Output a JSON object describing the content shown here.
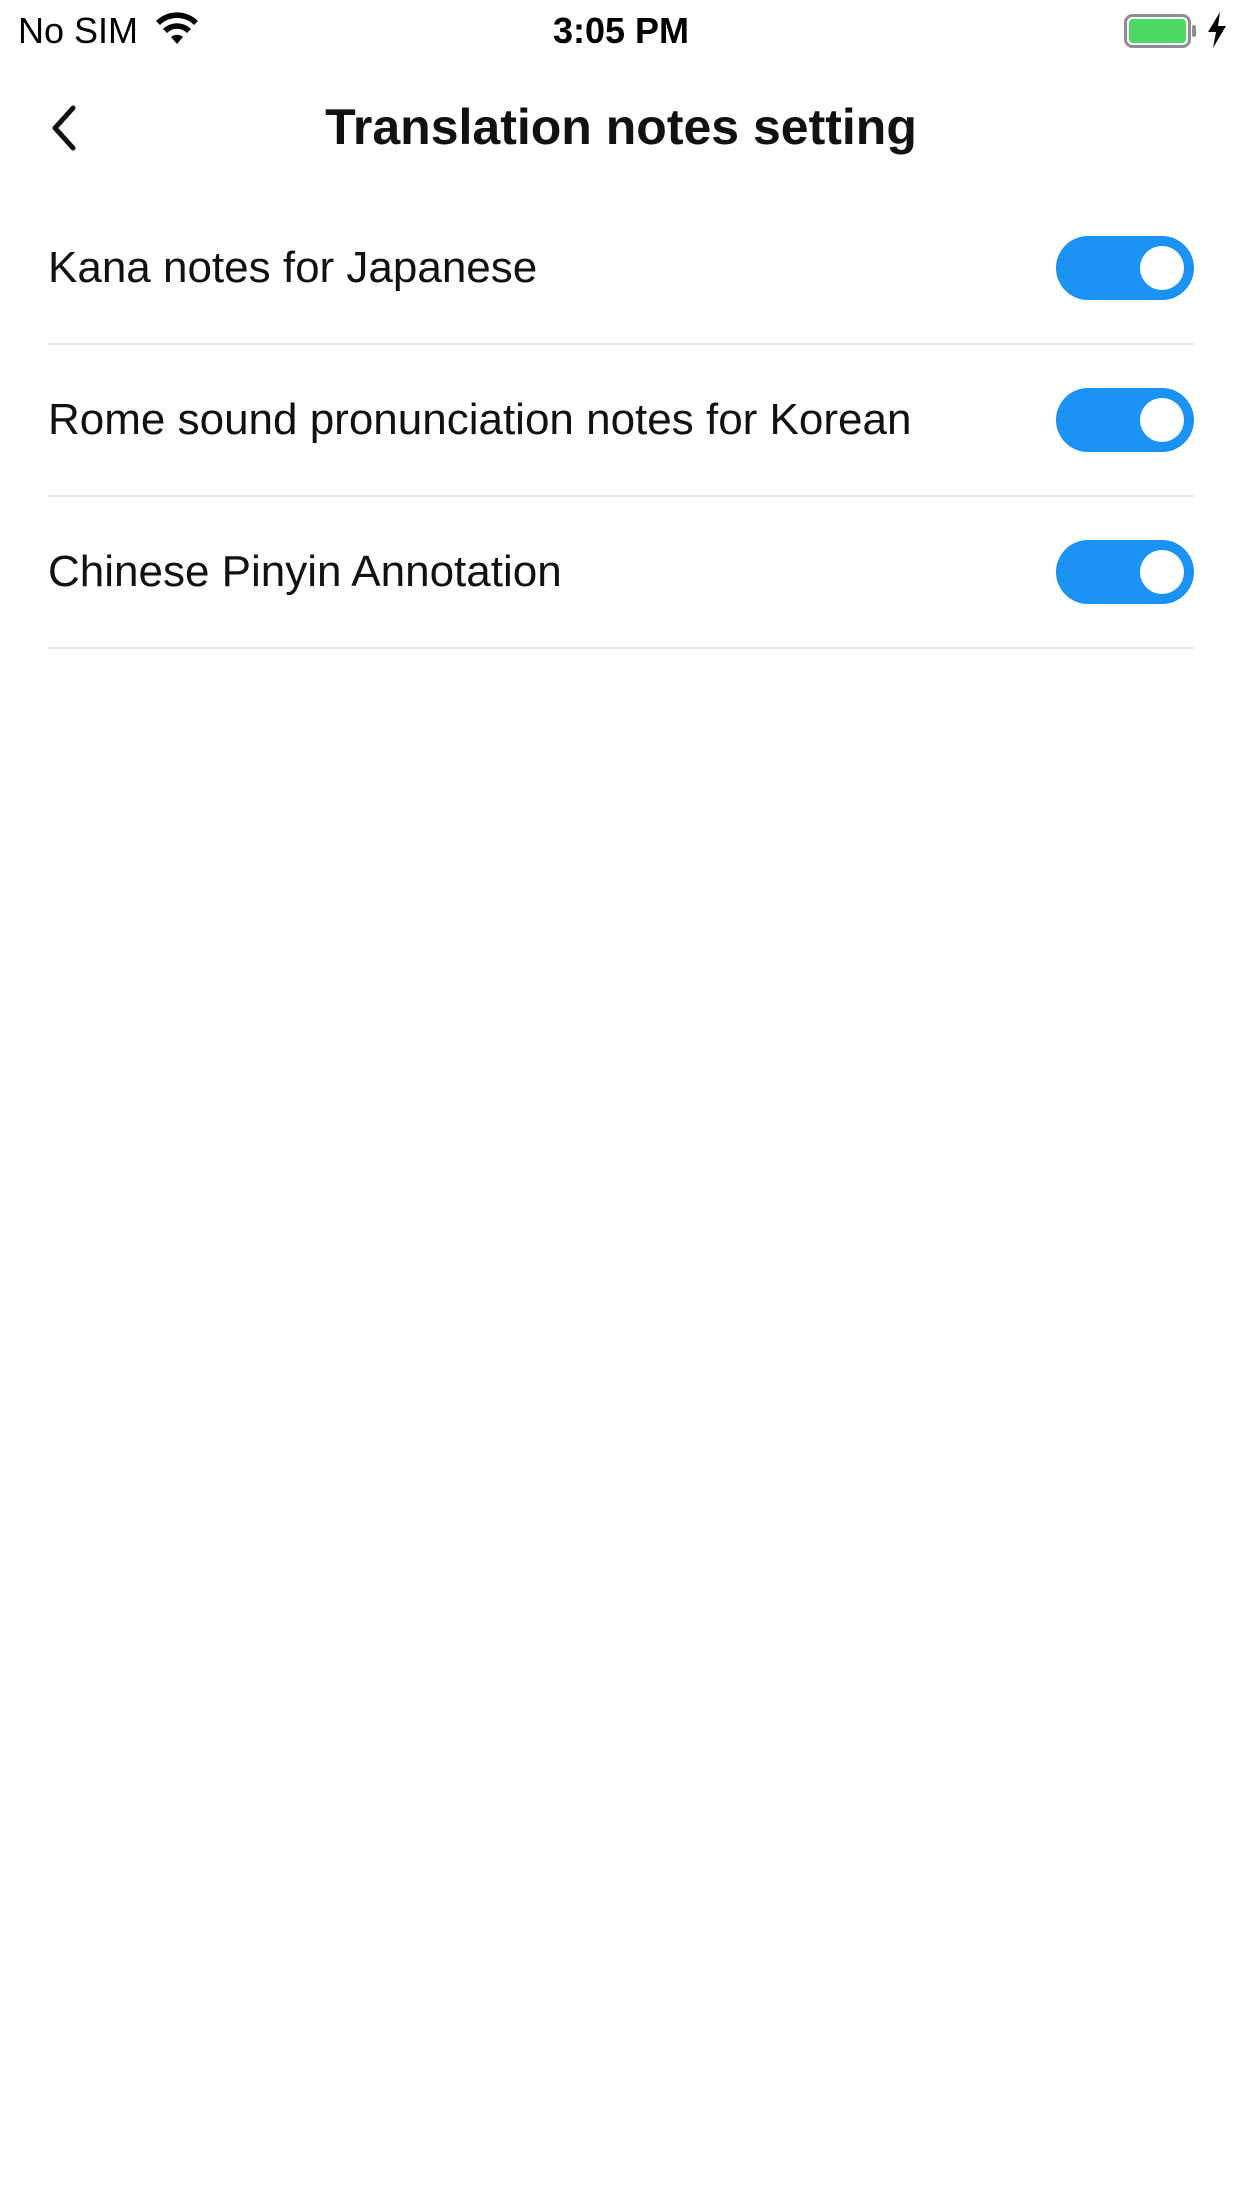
{
  "status_bar": {
    "carrier": "No SIM",
    "time": "3:05 PM",
    "wifi_icon": "wifi-icon",
    "battery_icon": "battery-icon",
    "charging_icon": "charging-bolt-icon",
    "battery_color": "#4cd964"
  },
  "nav": {
    "back_icon": "chevron-left-icon",
    "title": "Translation notes setting"
  },
  "settings": {
    "items": [
      {
        "label": "Kana notes for Japanese",
        "enabled": true
      },
      {
        "label": "Rome sound pronunciation notes for Korean",
        "enabled": true
      },
      {
        "label": "Chinese Pinyin Annotation",
        "enabled": true
      }
    ]
  },
  "colors": {
    "accent": "#1a93f5",
    "divider": "#e8e8e8",
    "text": "#111111"
  }
}
